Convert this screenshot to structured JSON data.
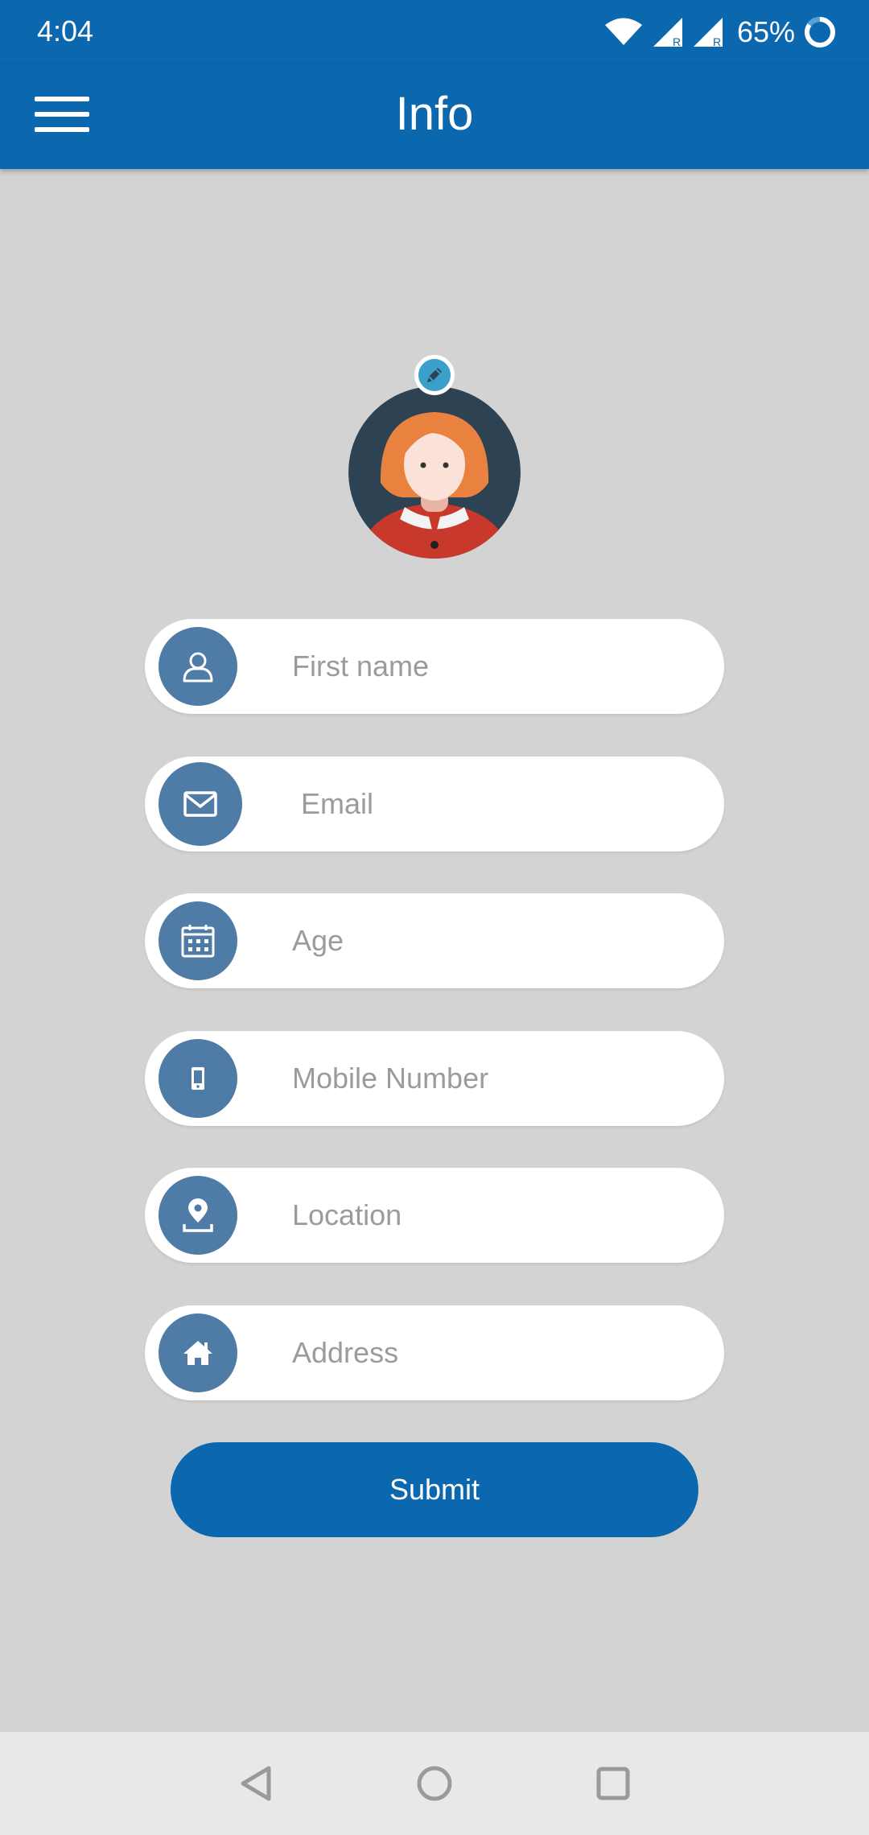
{
  "status_bar": {
    "time": "4:04",
    "battery": "65%",
    "icons": [
      "wifi-icon",
      "signal-r-icon",
      "signal-r-icon",
      "battery-ring-icon"
    ]
  },
  "app_bar": {
    "title": "Info",
    "menu_icon": "hamburger-menu-icon"
  },
  "profile": {
    "avatar_icon": "female-avatar-icon",
    "edit_icon": "pencil-icon"
  },
  "form": {
    "fields": [
      {
        "placeholder": "First name",
        "value": "",
        "icon": "person-icon"
      },
      {
        "placeholder": "Email",
        "value": "",
        "icon": "envelope-icon"
      },
      {
        "placeholder": "Age",
        "value": "",
        "icon": "calendar-icon"
      },
      {
        "placeholder": "Mobile Number",
        "value": "",
        "icon": "mobile-phone-icon"
      },
      {
        "placeholder": "Location",
        "value": "",
        "icon": "map-pin-icon"
      },
      {
        "placeholder": "Address",
        "value": "",
        "icon": "home-icon"
      }
    ],
    "submit_label": "Submit"
  },
  "nav_bar": {
    "icons": [
      "back-triangle-icon",
      "home-circle-icon",
      "recents-square-icon"
    ]
  },
  "colors": {
    "primary": "#0b67ae",
    "background": "#d3d3d3",
    "icon_circle": "#4e7ca6",
    "edit_badge": "#3aa0c9",
    "placeholder": "#9b9b9b"
  }
}
